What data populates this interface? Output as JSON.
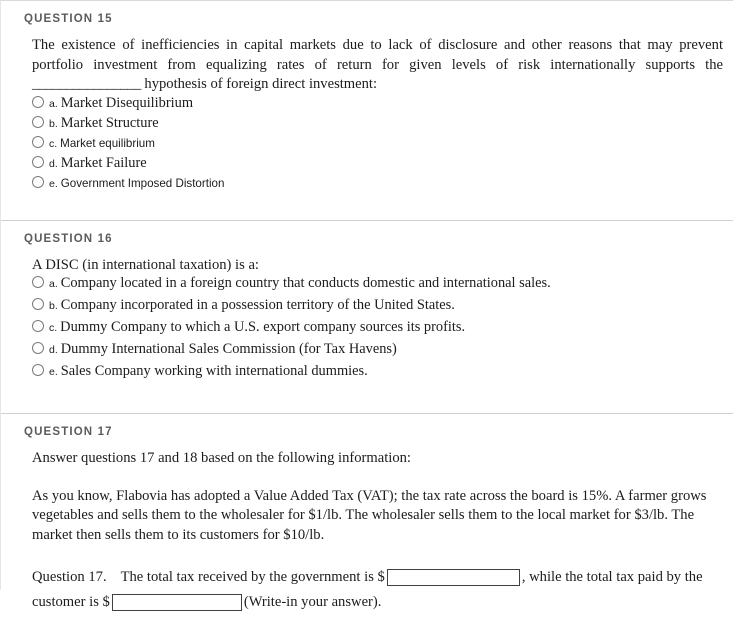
{
  "page": {
    "background": "#ffffff",
    "header_color": "#5b5b5b",
    "text_color": "#1c1c1c"
  },
  "questions": [
    {
      "header": "QUESTION 15",
      "stem_part1": "The existence of inefficiencies in capital markets due to lack of disclosure and other reasons that may prevent portfolio investment from equalizing rates of return for given levels of risk internationally supports the ",
      "stem_blank": "________________",
      "stem_part2": " hypothesis of foreign direct investment:",
      "options": [
        {
          "letter": "a.",
          "text": "Market Disequilibrium",
          "font": "serif"
        },
        {
          "letter": "b.",
          "text": "Market Structure",
          "font": "serif"
        },
        {
          "letter": "c.",
          "text": "Market equilibrium",
          "font": "sans"
        },
        {
          "letter": "d.",
          "text": "Market Failure",
          "font": "serif"
        },
        {
          "letter": "e.",
          "text": "Government Imposed Distortion",
          "font": "sans"
        }
      ]
    },
    {
      "header": "QUESTION 16",
      "stem": "A DISC (in international taxation) is a:",
      "options": [
        {
          "letter": "a.",
          "text": "Company located in a foreign country that conducts domestic and international sales.",
          "font": "serif"
        },
        {
          "letter": "b.",
          "text": "Company incorporated in a possession territory of the United States.",
          "font": "serif"
        },
        {
          "letter": "c.",
          "text": "Dummy Company to which a U.S. export company sources its profits.",
          "font": "serif"
        },
        {
          "letter": "d.",
          "text": "Dummy International Sales Commission (for Tax Havens)",
          "font": "serif"
        },
        {
          "letter": "e.",
          "text": "Sales Company working with international dummies.",
          "font": "serif"
        }
      ]
    },
    {
      "header": "QUESTION 17",
      "intro": "Answer questions 17 and 18 based on the following information:",
      "scenario": "As you know, Flabovia has adopted a Value Added Tax (VAT); the tax rate across the board is 15%. A farmer grows vegetables and sells them to the wholesaler for $1/lb.   The wholesaler sells them to the local market for $3/lb. The market then sells them to its customers for $10/lb.",
      "answer_prompt_label": "Question 17.",
      "answer_prompt_a": "The total tax received by the government is $",
      "answer_input_1_value": "",
      "answer_input_1_placeholder": "",
      "answer_prompt_b": ", while the total tax paid by the customer is $",
      "answer_input_2_value": "",
      "answer_input_2_placeholder": "",
      "answer_prompt_c": "(Write-in your answer)."
    }
  ]
}
